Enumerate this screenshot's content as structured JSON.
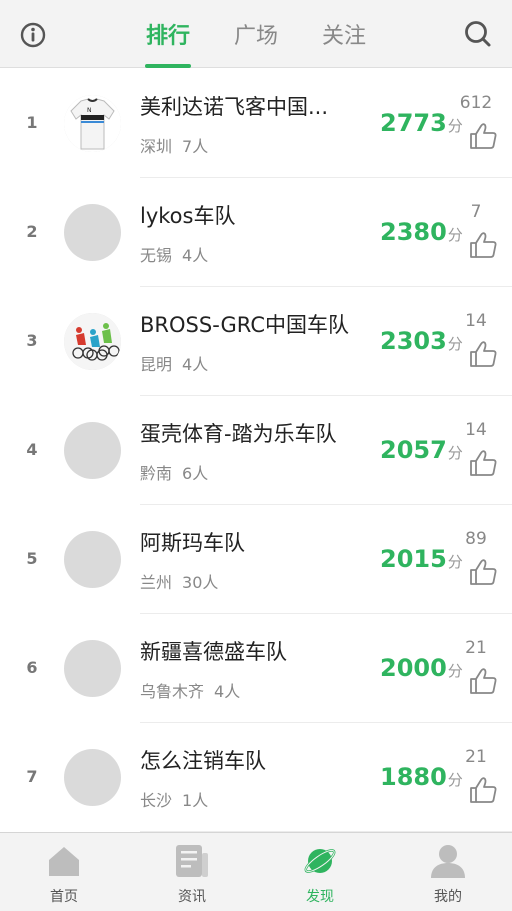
{
  "header": {
    "tabs": [
      {
        "label": "排行",
        "active": true
      },
      {
        "label": "广场",
        "active": false
      },
      {
        "label": "关注",
        "active": false
      }
    ],
    "info_icon": "info-icon",
    "search_icon": "search-icon"
  },
  "colors": {
    "accent": "#2fb45f",
    "header_bg": "#f3f3f3",
    "avatar_placeholder": "#dadada"
  },
  "score_unit": "分",
  "teams": [
    {
      "rank": "1",
      "name": "美利达诺飞客中国...",
      "city": "深圳",
      "members": "7人",
      "score": "2773",
      "likes": "612",
      "avatar": "jersey"
    },
    {
      "rank": "2",
      "name": "lykos车队",
      "city": "无锡",
      "members": "4人",
      "score": "2380",
      "likes": "7",
      "avatar": "placeholder"
    },
    {
      "rank": "3",
      "name": "BROSS-GRC中国车队",
      "city": "昆明",
      "members": "4人",
      "score": "2303",
      "likes": "14",
      "avatar": "cyclists"
    },
    {
      "rank": "4",
      "name": "蛋壳体育-踏为乐车队",
      "city": "黔南",
      "members": "6人",
      "score": "2057",
      "likes": "14",
      "avatar": "placeholder"
    },
    {
      "rank": "5",
      "name": "阿斯玛车队",
      "city": "兰州",
      "members": "30人",
      "score": "2015",
      "likes": "89",
      "avatar": "placeholder"
    },
    {
      "rank": "6",
      "name": "新疆喜德盛车队",
      "city": "乌鲁木齐",
      "members": "4人",
      "score": "2000",
      "likes": "21",
      "avatar": "placeholder"
    },
    {
      "rank": "7",
      "name": "怎么注销车队",
      "city": "长沙",
      "members": "1人",
      "score": "1880",
      "likes": "21",
      "avatar": "placeholder"
    }
  ],
  "bottom_nav": [
    {
      "label": "首页",
      "icon": "home-icon",
      "active": false
    },
    {
      "label": "资讯",
      "icon": "news-icon",
      "active": false
    },
    {
      "label": "发现",
      "icon": "discover-icon",
      "active": true
    },
    {
      "label": "我的",
      "icon": "profile-icon",
      "active": false
    }
  ]
}
